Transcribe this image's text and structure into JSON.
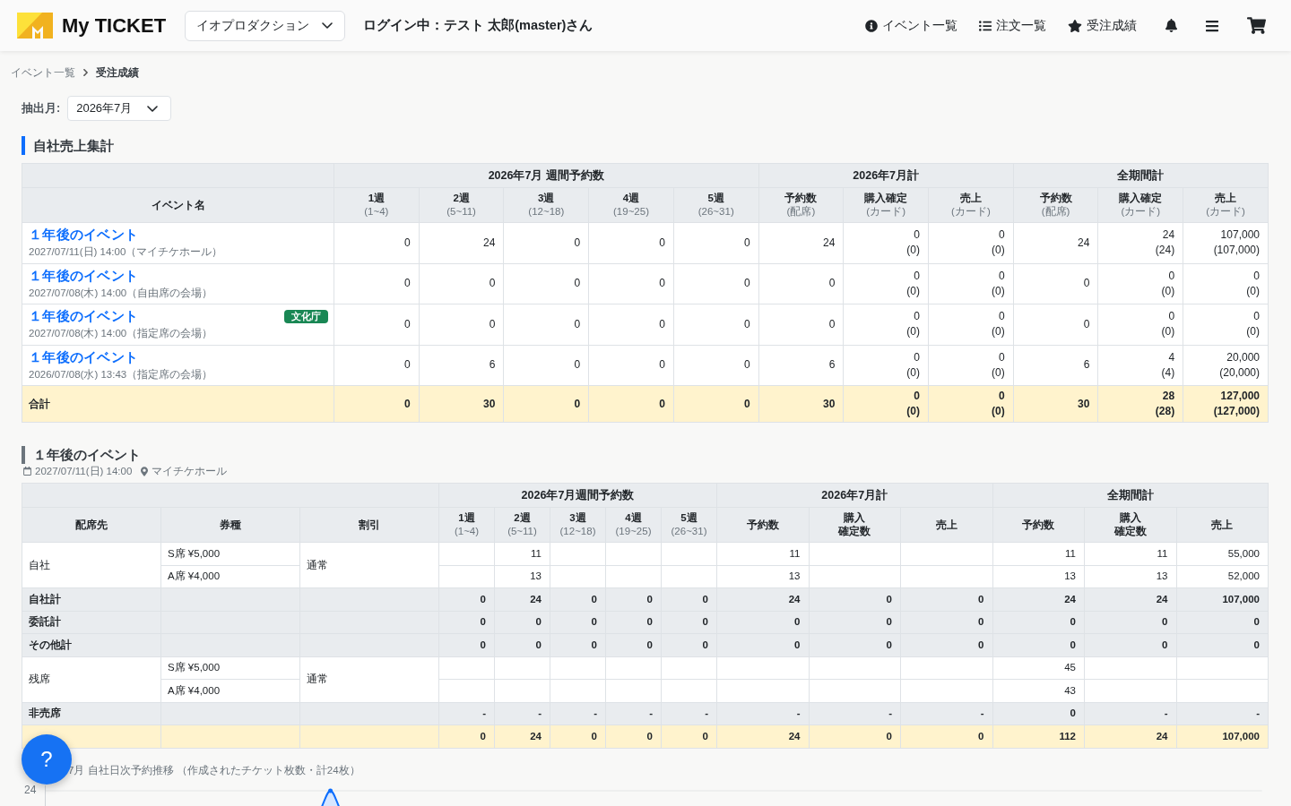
{
  "header": {
    "brand": "My TICKET",
    "company_select": {
      "value": "イオプロダクション"
    },
    "login_status": "ログイン中：テスト 太郎(master)さん",
    "nav": [
      {
        "kind": "info",
        "label": "イベント一覧"
      },
      {
        "kind": "list",
        "label": "注文一覧"
      },
      {
        "kind": "star",
        "label": "受注成績"
      }
    ],
    "icon_buttons": [
      {
        "kind": "bell"
      },
      {
        "kind": "menu"
      },
      {
        "kind": "cart"
      }
    ]
  },
  "breadcrumb": [
    {
      "label": "イベント一覧",
      "current": false
    },
    {
      "label": "受注成績",
      "current": true
    }
  ],
  "filter": {
    "label": "抽出月:",
    "value": "2026年7月"
  },
  "sales_summary": {
    "title": "自社売上集計",
    "name_column": "イベント名",
    "column_groups": [
      {
        "title": "2026年7月 週間予約数",
        "columns": [
          {
            "label": "1週",
            "range": "(1~4)"
          },
          {
            "label": "2週",
            "range": "(5~11)"
          },
          {
            "label": "3週",
            "range": "(12~18)"
          },
          {
            "label": "4週",
            "range": "(19~25)"
          },
          {
            "label": "5週",
            "range": "(26~31)"
          }
        ]
      },
      {
        "title": "2026年7月計",
        "columns": [
          {
            "label": "予約数",
            "range": "(配席)"
          },
          {
            "label": "購入確定",
            "range": "(カード)"
          },
          {
            "label": "売上",
            "range": "(カード)"
          }
        ]
      },
      {
        "title": "全期間計",
        "columns": [
          {
            "label": "予約数",
            "range": "(配席)"
          },
          {
            "label": "購入確定",
            "range": "(カード)"
          },
          {
            "label": "売上",
            "range": "(カード)"
          }
        ]
      }
    ],
    "rows": [
      {
        "kind": "event",
        "name": "１年後のイベント",
        "schedule": "2027/07/11(日) 14:00（マイチケホール）",
        "cells": [
          "0",
          "24",
          "0",
          "0",
          "0",
          "24",
          [
            "0",
            "(0)"
          ],
          [
            "0",
            "(0)"
          ],
          "24",
          [
            "24",
            "(24)"
          ],
          [
            "107,000",
            "(107,000)"
          ]
        ]
      },
      {
        "kind": "event",
        "name": "１年後のイベント",
        "schedule": "2027/07/08(木) 14:00（自由席の会場）",
        "cells": [
          "0",
          "0",
          "0",
          "0",
          "0",
          "0",
          [
            "0",
            "(0)"
          ],
          [
            "0",
            "(0)"
          ],
          "0",
          [
            "0",
            "(0)"
          ],
          [
            "0",
            "(0)"
          ]
        ]
      },
      {
        "kind": "event",
        "name": "１年後のイベント",
        "badge": "文化庁",
        "schedule": "2027/07/08(木) 14:00（指定席の会場）",
        "cells": [
          "0",
          "0",
          "0",
          "0",
          "0",
          "0",
          [
            "0",
            "(0)"
          ],
          [
            "0",
            "(0)"
          ],
          "0",
          [
            "0",
            "(0)"
          ],
          [
            "0",
            "(0)"
          ]
        ]
      },
      {
        "kind": "event",
        "name": "１年後のイベント",
        "schedule": "2026/07/08(水) 13:43（指定席の会場）",
        "cells": [
          "0",
          "6",
          "0",
          "0",
          "0",
          "6",
          [
            "0",
            "(0)"
          ],
          [
            "0",
            "(0)"
          ],
          "6",
          [
            "4",
            "(4)"
          ],
          [
            "20,000",
            "(20,000)"
          ]
        ]
      },
      {
        "kind": "total",
        "label": "合計",
        "cells": [
          "0",
          "30",
          "0",
          "0",
          "0",
          "30",
          [
            "0",
            "(0)"
          ],
          [
            "0",
            "(0)"
          ],
          "30",
          [
            "28",
            "(28)"
          ],
          [
            "127,000",
            "(127,000)"
          ]
        ]
      }
    ]
  },
  "event_detail": {
    "title": "１年後のイベント",
    "date": "2027/07/11(日) 14:00",
    "venue": "マイチケホール",
    "fixed_columns": [
      "配席先",
      "券種",
      "割引"
    ],
    "column_groups": [
      {
        "title": "2026年7月週間予約数",
        "columns": [
          {
            "label": "1週",
            "range": "(1~4)"
          },
          {
            "label": "2週",
            "range": "(5~11)"
          },
          {
            "label": "3週",
            "range": "(12~18)"
          },
          {
            "label": "4週",
            "range": "(19~25)"
          },
          {
            "label": "5週",
            "range": "(26~31)"
          }
        ]
      },
      {
        "title": "2026年7月計",
        "columns": [
          {
            "label": "予約数"
          },
          {
            "label": [
              "購入",
              "確定数"
            ]
          },
          {
            "label": "売上"
          }
        ]
      },
      {
        "title": "全期間計",
        "columns": [
          {
            "label": "予約数"
          },
          {
            "label": [
              "購入",
              "確定数"
            ]
          },
          {
            "label": "売上"
          }
        ]
      }
    ],
    "rows": [
      {
        "kind": "group",
        "destination": "自社",
        "discount": "通常",
        "items": [
          {
            "ticket": "S席 ¥5,000",
            "cells": [
              null,
              "11",
              null,
              null,
              null,
              "11",
              null,
              null,
              "11",
              "11",
              "55,000"
            ]
          },
          {
            "ticket": "A席 ¥4,000",
            "cells": [
              null,
              "13",
              null,
              null,
              null,
              "13",
              null,
              null,
              "13",
              "13",
              "52,000"
            ]
          }
        ]
      },
      {
        "kind": "subtotal",
        "label": "自社計",
        "cells": [
          "0",
          "24",
          "0",
          "0",
          "0",
          "24",
          "0",
          "0",
          "24",
          "24",
          "107,000"
        ]
      },
      {
        "kind": "subtotal",
        "label": "委託計",
        "cells": [
          "0",
          "0",
          "0",
          "0",
          "0",
          "0",
          "0",
          "0",
          "0",
          "0",
          "0"
        ]
      },
      {
        "kind": "subtotal",
        "label": "その他計",
        "cells": [
          "0",
          "0",
          "0",
          "0",
          "0",
          "0",
          "0",
          "0",
          "0",
          "0",
          "0"
        ]
      },
      {
        "kind": "group",
        "destination": "残席",
        "discount": "通常",
        "items": [
          {
            "ticket": "S席 ¥5,000",
            "cells": [
              null,
              null,
              null,
              null,
              null,
              null,
              null,
              null,
              "45",
              null,
              null
            ]
          },
          {
            "ticket": "A席 ¥4,000",
            "cells": [
              null,
              null,
              null,
              null,
              null,
              null,
              null,
              null,
              "43",
              null,
              null
            ]
          }
        ]
      },
      {
        "kind": "subtotal",
        "label": "非売席",
        "cells": [
          "-",
          "-",
          "-",
          "-",
          "-",
          "-",
          "-",
          "-",
          "0",
          "-",
          "-"
        ]
      },
      {
        "kind": "total",
        "cells": [
          "0",
          "24",
          "0",
          "0",
          "0",
          "24",
          "0",
          "0",
          "112",
          "24",
          "107,000"
        ]
      }
    ]
  },
  "daily_chart": {
    "title": "7月 自社日次予約推移 （作成されたチケット枚数・計24枚）",
    "y_tick_labels": [
      "24"
    ]
  },
  "help_button": {
    "label": "?"
  }
}
